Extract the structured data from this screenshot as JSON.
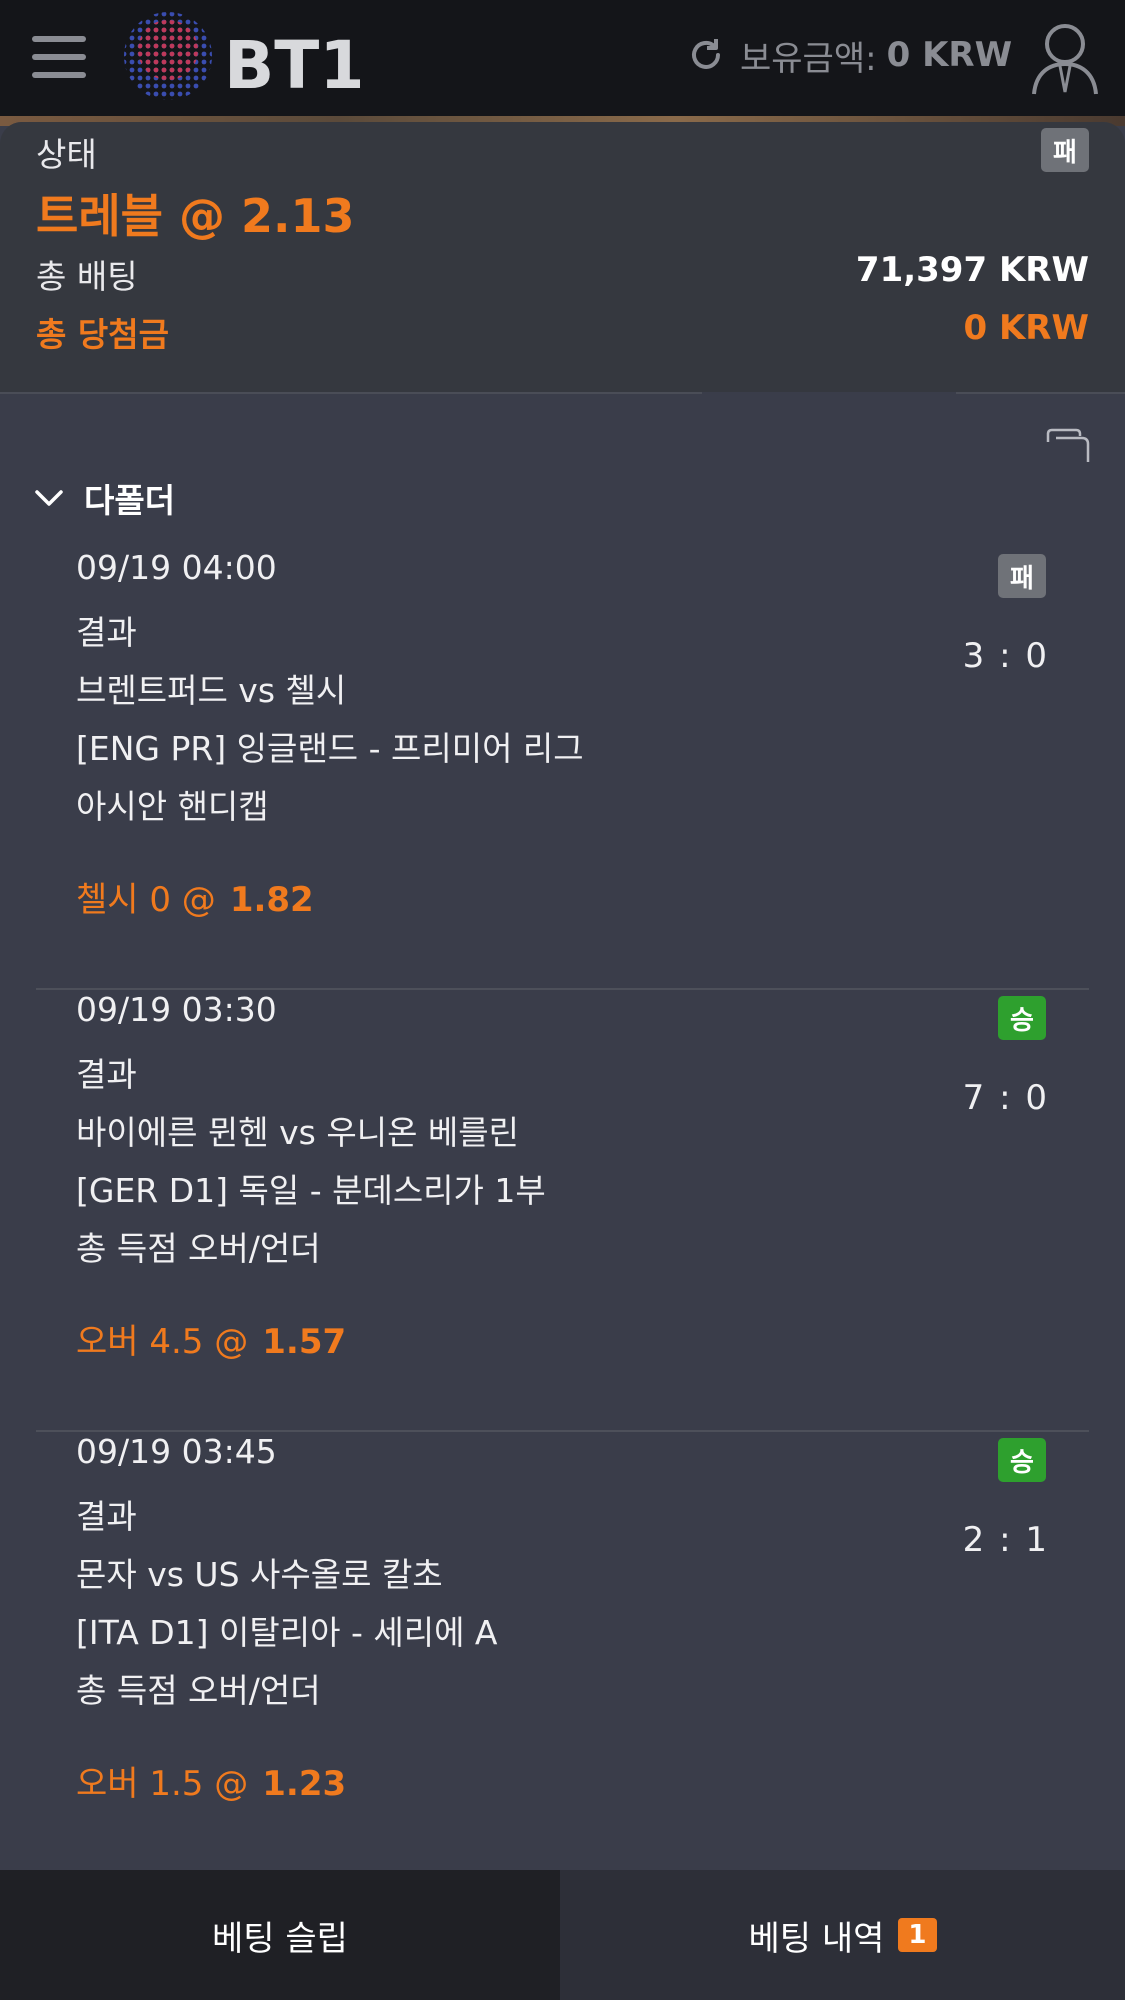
{
  "header": {
    "logo_text": "BT1",
    "balance_label": "보유금액:",
    "balance_value": "0 KRW"
  },
  "summary": {
    "status_label": "상태",
    "status_badge": "패",
    "bet_type": "트레블 @ 2.13",
    "total_bet_label": "총 배팅",
    "total_bet_value": "71,397 KRW",
    "total_win_label": "총 당첨금",
    "total_win_value": "0 KRW"
  },
  "section": {
    "title": "다폴더"
  },
  "legs": [
    {
      "datetime": "09/19 04:00",
      "result_label": "결과",
      "badge": "패",
      "score": "3 : 0",
      "match": "브렌트퍼드 vs 첼시",
      "league": "[ENG PR] 잉글랜드 - 프리미어 리그",
      "market": "아시안 핸디캡",
      "pick": "첼시 0 @",
      "odds": "1.82"
    },
    {
      "datetime": "09/19 03:30",
      "result_label": "결과",
      "badge": "승",
      "score": "7 : 0",
      "match": "바이에른 뮌헨 vs 우니온 베를린",
      "league": "[GER D1] 독일 - 분데스리가 1부",
      "market": "총 득점 오버/언더",
      "pick": "오버 4.5 @",
      "odds": "1.57"
    },
    {
      "datetime": "09/19 03:45",
      "result_label": "결과",
      "badge": "승",
      "score": "2 : 1",
      "match": "몬자 vs US 사수올로 칼초",
      "league": "[ITA D1] 이탈리아 - 세리에 A",
      "market": "총 득점 오버/언더",
      "pick": "오버 1.5 @",
      "odds": "1.23"
    }
  ],
  "tabs": {
    "slip": "베팅 슬립",
    "history": "베팅 내역",
    "history_count": "1"
  },
  "colors": {
    "accent": "#f07a1e",
    "win": "#2ea02e",
    "lose": "#6f7278"
  }
}
